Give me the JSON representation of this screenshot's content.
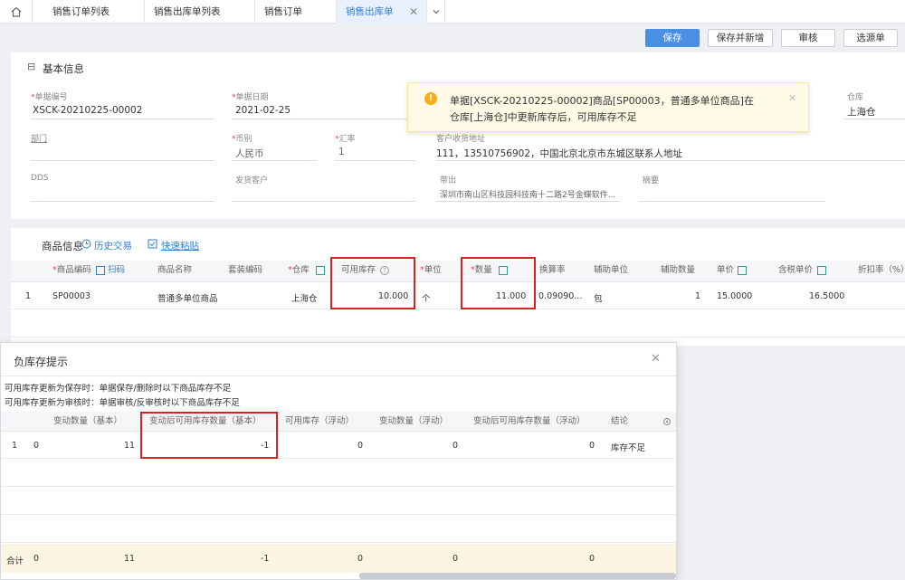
{
  "tabs": {
    "home_icon": "home-icon",
    "t1": "销售订单列表",
    "t2": "销售出库单列表",
    "t3": "销售订单",
    "t4": "销售出库单",
    "close": "✕"
  },
  "toolbar": {
    "save": "保存",
    "save_new": "保存并新增",
    "audit": "审核",
    "select_source": "选源单"
  },
  "basic": {
    "title": "基本信息",
    "collapse": "⊟",
    "doc_no_label": "单据编号",
    "doc_no": "XSCK-20210225-00002",
    "doc_date_label": "单据日期",
    "doc_date": "2021-02-25",
    "warehouse_label": "仓库",
    "warehouse": "上海仓",
    "dept_label": "部门",
    "currency_label": "币别",
    "currency": "人民币",
    "rate_label": "汇率",
    "rate": "1",
    "address_label": "客户收货地址",
    "address": "111，13510756902，中国北京北京市东城区联系人地址",
    "dds_label": "DDS",
    "ship_cust_label": "发货客户",
    "takeout_label": "带出",
    "takeout": "深圳市南山区科技园科技南十二路2号金蝶软件...",
    "summary_label": "摘要",
    "star": "*"
  },
  "toast": {
    "line1": "单据[XSCK-20210225-00002]商品[SP00003，普通多单位商品]在",
    "line2": "仓库[上海仓]中更新库存后，可用库存不足",
    "icon": "!",
    "close": "✕"
  },
  "goods": {
    "title": "商品信息",
    "history": "历史交易",
    "paste": "快速粘贴",
    "headers": {
      "code": "商品编码",
      "scan": "扫码",
      "name": "商品名称",
      "kit": "套装编码",
      "wh": "仓库",
      "avail": "可用库存",
      "unit": "单位",
      "qty": "数量",
      "conv": "换算率",
      "aux_unit": "辅助单位",
      "aux_qty": "辅助数量",
      "price": "单价",
      "tax_price": "含税单价",
      "discount": "折扣率（%）"
    },
    "row": {
      "no": "1",
      "code": "SP00003",
      "name": "普通多单位商品",
      "wh": "上海仓",
      "avail": "10.000",
      "unit": "个",
      "qty": "11.000",
      "conv": "0.09090...",
      "aux_unit": "包",
      "aux_qty": "1",
      "price": "15.0000",
      "tax_price": "16.5000"
    }
  },
  "dialog": {
    "title": "负库存提示",
    "close": "✕",
    "note1": "可用库存更新为保存时：单据保存/删除时以下商品库存不足",
    "note2": "可用库存更新为审核时：单据审核/反审核时以下商品库存不足",
    "headers": {
      "chg_qty": "变动数量（基本）",
      "after_avail": "变动后可用库存数量（基本）",
      "avail_float": "可用库存（浮动）",
      "chg_float": "变动数量（浮动）",
      "after_float": "变动后可用库存数量（浮动）",
      "result": "结论"
    },
    "row": {
      "no": "1",
      "c0": "0",
      "chg_qty": "11",
      "after_avail": "-1",
      "avail_float": "0",
      "chg_float": "0",
      "after_float": "0",
      "result": "库存不足"
    },
    "total": {
      "label": "合计",
      "c0": "0",
      "chg_qty": "11",
      "after_avail": "-1",
      "avail_float": "0",
      "chg_float": "0",
      "after_float": "0"
    }
  }
}
